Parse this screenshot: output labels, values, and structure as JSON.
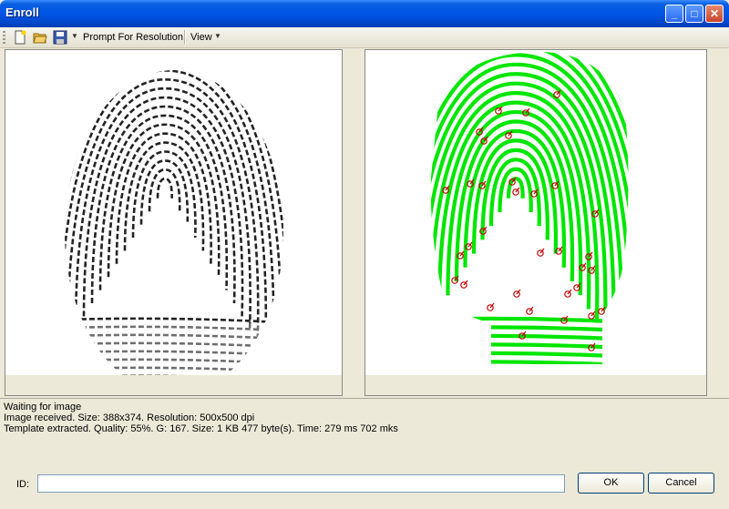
{
  "window": {
    "title": "Enroll"
  },
  "title_buttons": {
    "minimize": "_",
    "maximize": "□",
    "close": "✕"
  },
  "toolbar": {
    "icons": [
      "new-document-icon",
      "open-folder-icon",
      "save-disk-icon"
    ],
    "prompt_label": "Prompt For Resolution",
    "view_label": "View"
  },
  "log": {
    "lines": [
      "Waiting for image",
      "Image received. Size: 388x374. Resolution: 500x500 dpi",
      "Template extracted. Quality: 55%. G: 167. Size: 1 KB 477 byte(s). Time: 279 ms 702 mks"
    ]
  },
  "form": {
    "id_label": "ID:",
    "id_value": "",
    "ok_label": "OK",
    "cancel_label": "Cancel"
  },
  "colors": {
    "ridge_green": "#00e600",
    "minutia_red": "#c00000",
    "title_blue": "#0055e5"
  }
}
